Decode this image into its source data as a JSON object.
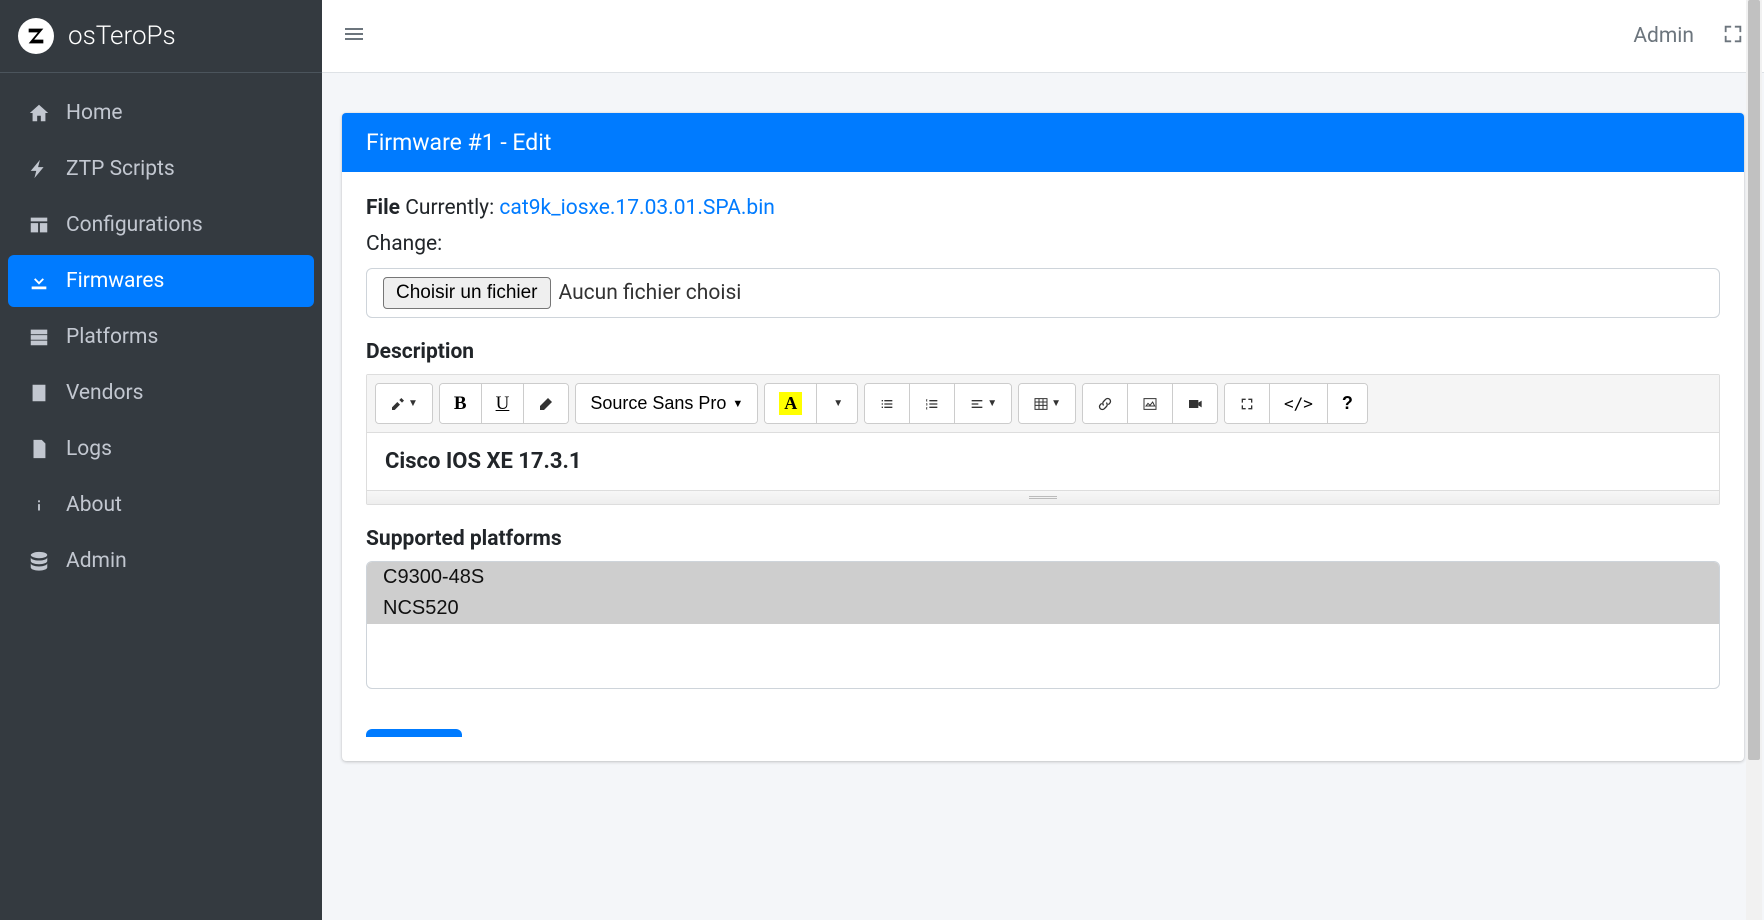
{
  "brand": {
    "name": "osTeroPs"
  },
  "sidebar": {
    "items": [
      {
        "label": "Home",
        "icon": "home"
      },
      {
        "label": "ZTP Scripts",
        "icon": "bolt"
      },
      {
        "label": "Configurations",
        "icon": "table"
      },
      {
        "label": "Firmwares",
        "icon": "download",
        "active": true
      },
      {
        "label": "Platforms",
        "icon": "server"
      },
      {
        "label": "Vendors",
        "icon": "building"
      },
      {
        "label": "Logs",
        "icon": "file"
      },
      {
        "label": "About",
        "icon": "info"
      },
      {
        "label": "Admin",
        "icon": "database"
      }
    ]
  },
  "topbar": {
    "user": "Admin"
  },
  "card": {
    "title": "Firmware #1 - Edit"
  },
  "form": {
    "file_label": "File",
    "currently_label": " Currently: ",
    "current_file": "cat9k_iosxe.17.03.01.SPA.bin",
    "change_label": "Change:",
    "choose_button": "Choisir un fichier",
    "no_file": "Aucun fichier choisi",
    "description_label": "Description",
    "description_value": "Cisco IOS XE 17.3.1",
    "platforms_label": "Supported platforms",
    "platforms": [
      "C9300-48S",
      "NCS520"
    ]
  },
  "editor": {
    "font_family": "Source Sans Pro"
  }
}
